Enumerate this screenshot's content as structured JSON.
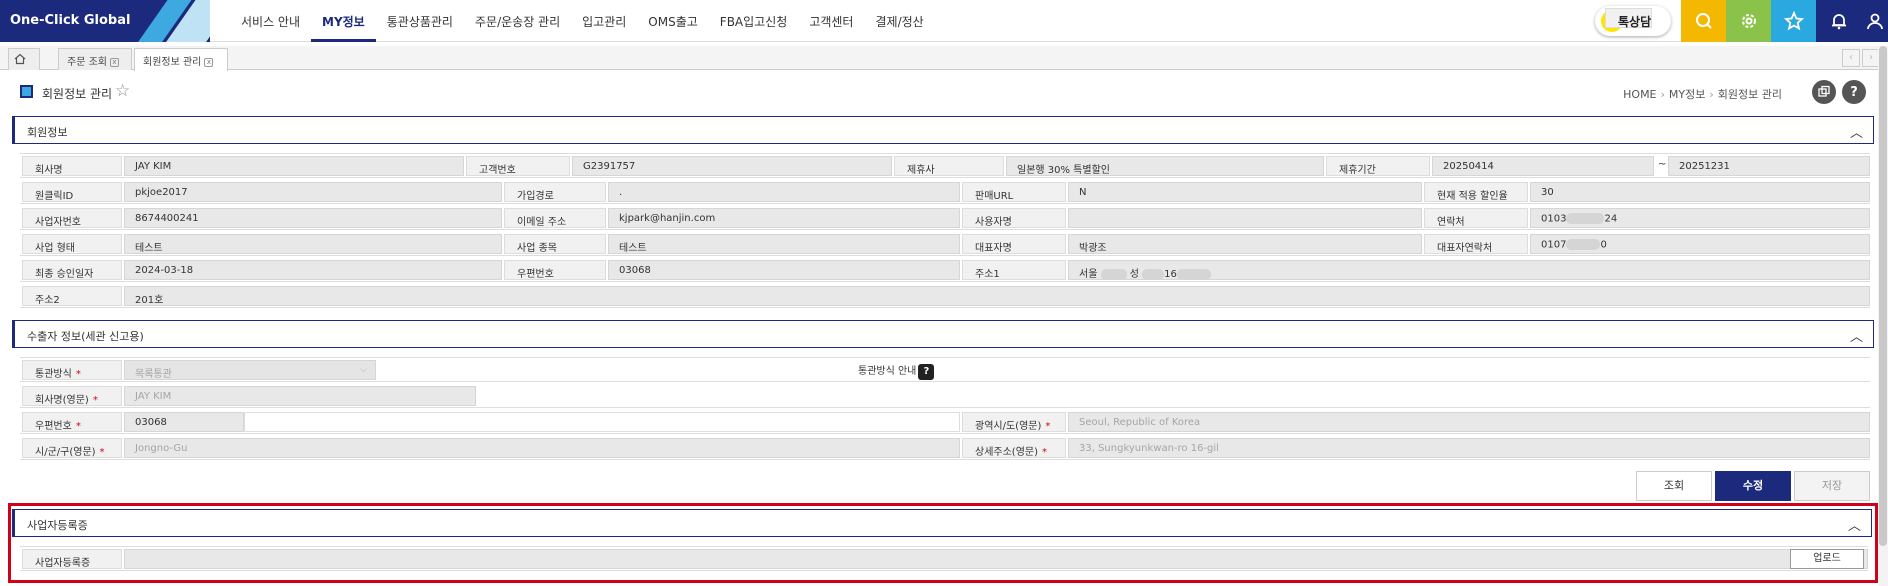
{
  "app": {
    "logo": "One-Click Global"
  },
  "nav": [
    {
      "label": "서비스 안내",
      "active": false
    },
    {
      "label": "MY정보",
      "active": true
    },
    {
      "label": "통관상품관리",
      "active": false
    },
    {
      "label": "주문/운송장 관리",
      "active": false
    },
    {
      "label": "입고관리",
      "active": false
    },
    {
      "label": "OMS출고",
      "active": false
    },
    {
      "label": "FBA입고신청",
      "active": false
    },
    {
      "label": "고객센터",
      "active": false
    },
    {
      "label": "결제/정산",
      "active": false
    }
  ],
  "chat": {
    "label": "톡상담"
  },
  "header_icons": [
    {
      "name": "search-icon",
      "color": "#f5b800"
    },
    {
      "name": "gear-icon",
      "color": "#8bc34a"
    },
    {
      "name": "star-icon",
      "color": "#29a9e0"
    },
    {
      "name": "bell-icon",
      "color": "#1b2a7c"
    },
    {
      "name": "user-icon",
      "color": "#1b2a7c"
    }
  ],
  "tabs": [
    {
      "label": "주문 조회"
    },
    {
      "label": "회원정보 관리"
    }
  ],
  "page": {
    "title": "회원정보 관리",
    "breadcrumb": [
      "HOME",
      "MY정보",
      "회원정보 관리"
    ]
  },
  "member": {
    "section_title": "회원정보",
    "labels": {
      "company": "회사명",
      "customer_no": "고객번호",
      "partner": "제휴사",
      "partner_period": "제휴기간",
      "id": "원클릭ID",
      "join_path": "가입경로",
      "sales_url": "판매URL",
      "discount": "현재 적용 할인율",
      "biz_no": "사업자번호",
      "email": "이메일 주소",
      "user_name": "사용자명",
      "contact": "연락처",
      "biz_type": "사업 형태",
      "biz_item": "사업 종목",
      "ceo": "대표자명",
      "ceo_contact": "대표자연락처",
      "approved": "최종 승인일자",
      "zip": "우편번호",
      "addr1": "주소1",
      "addr2": "주소2"
    },
    "values": {
      "company": "JAY KIM",
      "customer_no": "G2391757",
      "partner": "일본행 30% 특별할인",
      "period_from": "20250414",
      "period_sep": "~",
      "period_to": "20251231",
      "id": "pkjoe2017",
      "join_path": ".",
      "sales_url": "N",
      "discount": "30",
      "biz_no": "8674400241",
      "email": "kjpark@hanjin.com",
      "user_name": "",
      "contact_a": "0103",
      "contact_b": "24",
      "biz_type": "테스트",
      "biz_item": "테스트",
      "ceo": "박광조",
      "ceo_contact_a": "0107",
      "ceo_contact_b": "0",
      "approved": "2024-03-18",
      "zip": "03068",
      "addr1_a": "서울",
      "addr1_b": "성",
      "addr1_c": "16",
      "addr2": "201호"
    }
  },
  "exporter": {
    "section_title": "수출자 정보(세관 신고용)",
    "labels": {
      "method": "통관방식",
      "company_en": "회사명(영문)",
      "zip": "우편번호",
      "province_en": "광역시/도(영문)",
      "city_en": "시/군/구(영문)",
      "detail_en": "상세주소(영문)"
    },
    "method_value": "목록통관",
    "method_guide": "통관방식 안내",
    "guide_icon": "?",
    "company_en": "JAY KIM",
    "zip": "03068",
    "province_en": "Seoul, Republic of Korea",
    "city_en": "Jongno-Gu",
    "detail_en": "33, Sungkyunkwan-ro 16-gil",
    "buttons": {
      "search": "조회",
      "edit": "수정",
      "save": "저장"
    }
  },
  "bizreg": {
    "section_title": "사업자등록증",
    "label": "사업자등록증",
    "upload": "업로드"
  },
  "required_mark": "*"
}
